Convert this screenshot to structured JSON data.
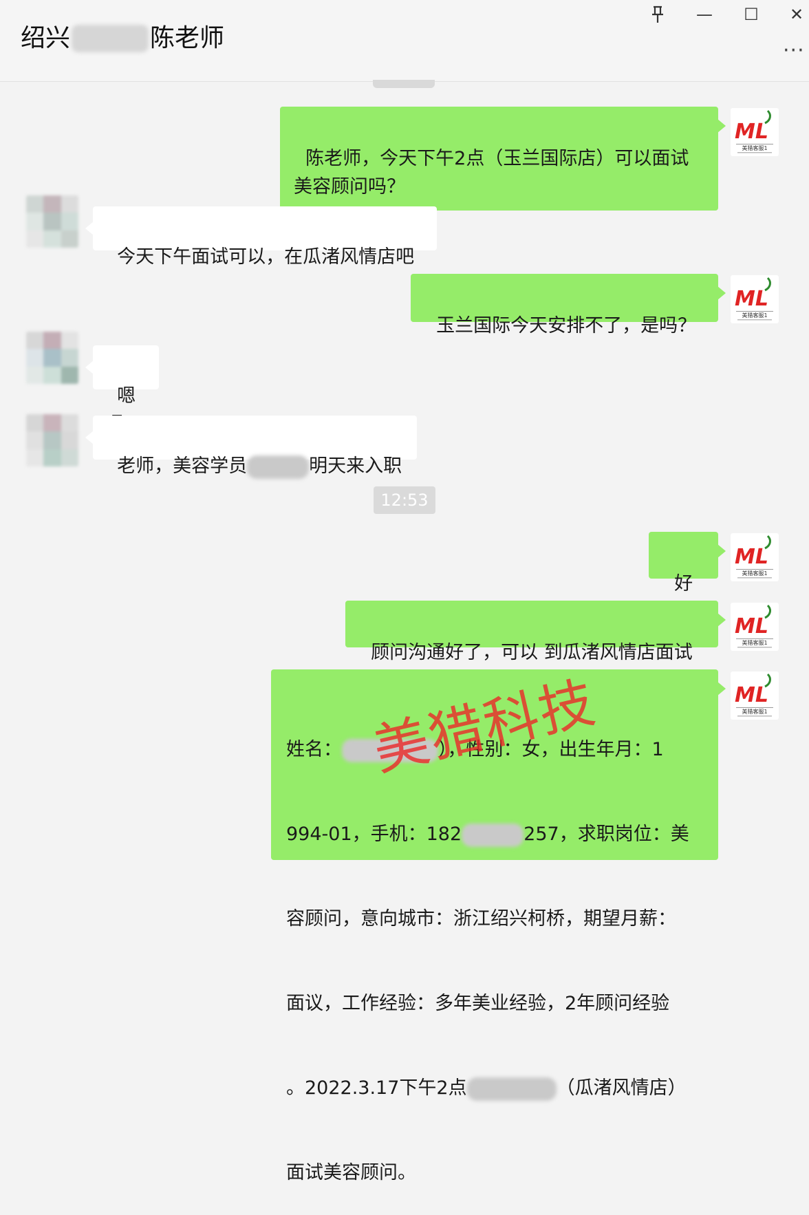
{
  "header": {
    "title_prefix": "绍兴",
    "title_suffix": "陈老师",
    "pin_icon": "pin-icon",
    "minimize_glyph": "—",
    "maximize_glyph": "☐",
    "close_glyph": "✕",
    "more_glyph": "···"
  },
  "messages": [
    {
      "side": "me",
      "text": "陈老师，今天下午2点（玉兰国际店）可以面试美容顾问吗？"
    },
    {
      "side": "them",
      "text": "今天下午面试可以，在瓜渚风情店吧"
    },
    {
      "side": "me",
      "text": "玉兰国际今天安排不了，是吗？"
    },
    {
      "side": "them",
      "text": "嗯嗯"
    },
    {
      "side": "them",
      "text_before": "老师，美容学员",
      "text_after": "明天来入职"
    },
    {
      "side": "me",
      "text": "好的"
    },
    {
      "side": "me",
      "text": "顾问沟通好了，可以 到瓜渚风情店面试"
    },
    {
      "side": "me",
      "lines": [
        {
          "before": "姓名：",
          "after": "），性别：女，出生年月：1"
        },
        {
          "before": "994-01，手机：182",
          "after": "257，求职岗位：美"
        },
        {
          "before": "容顾问，意向城市：浙江绍兴柯桥，期望月薪："
        },
        {
          "before": "面议，工作经验：多年美业经验，2年顾问经验"
        },
        {
          "before": "。2022.3.17下午2点",
          "after": "（瓜渚风情店）"
        },
        {
          "before": "面试美容顾问。"
        }
      ]
    }
  ],
  "time_divider": "12:53",
  "avatar_me": {
    "logo_text": "ML",
    "caption": "美猎客服1",
    "accent": "#e02424",
    "leaf": "#2e8b2e"
  },
  "watermark": "美猎科技",
  "colors": {
    "my_bubble": "#95ec69",
    "their_bubble": "#ffffff",
    "background": "#f3f3f3"
  }
}
